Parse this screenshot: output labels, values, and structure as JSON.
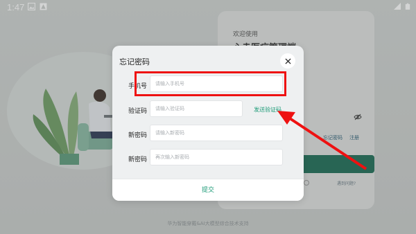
{
  "status_bar": {
    "time": "1:47",
    "left_icons": [
      "image-notification-icon",
      "app-notification-icon"
    ],
    "right_icons": [
      "signal-icon",
      "battery-icon"
    ]
  },
  "background": {
    "welcome": "欢迎使用",
    "app_title": "心赤医疗管理端",
    "forgot_link": "忘记密码",
    "register_link": "注册",
    "help_link": "遇到问题?",
    "footer": "华为智能穿戴&AI大模型综合技术支持"
  },
  "dialog": {
    "title": "忘记密码",
    "fields": [
      {
        "label": "手机号",
        "placeholder": "请输入手机号",
        "value": ""
      },
      {
        "label": "验证码",
        "placeholder": "请输入验证码",
        "value": ""
      },
      {
        "label": "新密码",
        "placeholder": "请输入新密码",
        "value": ""
      },
      {
        "label": "新密码",
        "placeholder": "再次输入新密码",
        "value": ""
      }
    ],
    "send_code": "发送验证码",
    "submit": "提交"
  },
  "colors": {
    "accent": "#1b9a76",
    "annotation": "#ee1111",
    "login_button": "#1b6b54"
  }
}
